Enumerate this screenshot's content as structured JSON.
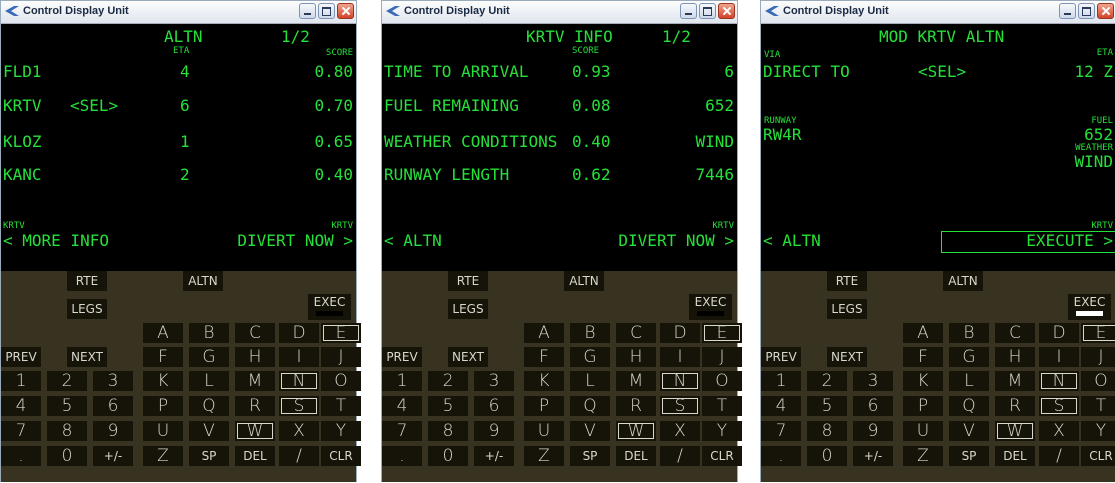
{
  "windows": [
    {
      "title": "Control Display Unit",
      "screen": {
        "title": "ALTN",
        "page": "1/2",
        "header_eta": "ETA",
        "header_score": "SCORE",
        "rows": [
          {
            "name": "FLD1",
            "sel": "",
            "eta": "4",
            "score": "0.80"
          },
          {
            "name": "KRTV",
            "sel": "<SEL>",
            "eta": "6",
            "score": "0.70"
          },
          {
            "name": "KLOZ",
            "sel": "",
            "eta": "1",
            "score": "0.65"
          },
          {
            "name": "KANC",
            "sel": "",
            "eta": "2",
            "score": "0.40"
          }
        ],
        "bottom_left_small": "KRTV",
        "bottom_right_small": "KRTV",
        "lsk_left": "< MORE INFO",
        "lsk_right": "DIVERT NOW >"
      },
      "exec_lit": false
    },
    {
      "title": "Control Display Unit",
      "screen": {
        "title": "KRTV INFO",
        "page": "1/2",
        "header_score": "SCORE",
        "rows": [
          {
            "label": "TIME TO ARRIVAL",
            "score": "0.93",
            "value": "6"
          },
          {
            "label": "FUEL REMAINING",
            "score": "0.08",
            "value": "652"
          },
          {
            "label": "WEATHER CONDITIONS",
            "score": "0.40",
            "value": "WIND"
          },
          {
            "label": "RUNWAY LENGTH",
            "score": "0.62",
            "value": "7446"
          }
        ],
        "bottom_right_small": "KRTV",
        "lsk_left": "< ALTN",
        "lsk_right": "DIVERT NOW >"
      },
      "exec_lit": false
    },
    {
      "title": "Control Display Unit",
      "screen": {
        "title": "MOD KRTV ALTN",
        "via_label": "VIA",
        "via_value": "DIRECT TO",
        "sel": "<SEL>",
        "eta_label": "ETA",
        "eta_value": "12 Z",
        "runway_label": "RUNWAY",
        "runway_value": "RW4R",
        "fuel_label": "FUEL",
        "fuel_value": "652",
        "weather_label": "WEATHER",
        "weather_value": "WIND",
        "bottom_right_small": "KRTV",
        "lsk_left": "< ALTN",
        "lsk_right": "EXECUTE >"
      },
      "exec_lit": true
    }
  ],
  "keyboard": {
    "rte": "RTE",
    "altn": "ALTN",
    "legs": "LEGS",
    "exec": "EXEC",
    "prev": "PREV",
    "next": "NEXT",
    "sp": "SP",
    "del": "DEL",
    "clr": "CLR",
    "plusminus": "+/-",
    "letters": [
      "A",
      "B",
      "C",
      "D",
      "E",
      "F",
      "G",
      "H",
      "I",
      "J",
      "K",
      "L",
      "M",
      "N",
      "O",
      "P",
      "Q",
      "R",
      "S",
      "T",
      "U",
      "V",
      "W",
      "X",
      "Y",
      "Z",
      "/"
    ],
    "digits": [
      "1",
      "2",
      "3",
      "4",
      "5",
      "6",
      "7",
      "8",
      "9",
      ".",
      "0"
    ],
    "highlighted_letters": [
      "E",
      "N",
      "S",
      "W"
    ]
  },
  "colors": {
    "screen_text": "#26e03a",
    "keyboard_bg": "#383221",
    "key_bg": "#161308",
    "key_text": "#d8d8cc",
    "exec_light_on": "#ffffff"
  }
}
